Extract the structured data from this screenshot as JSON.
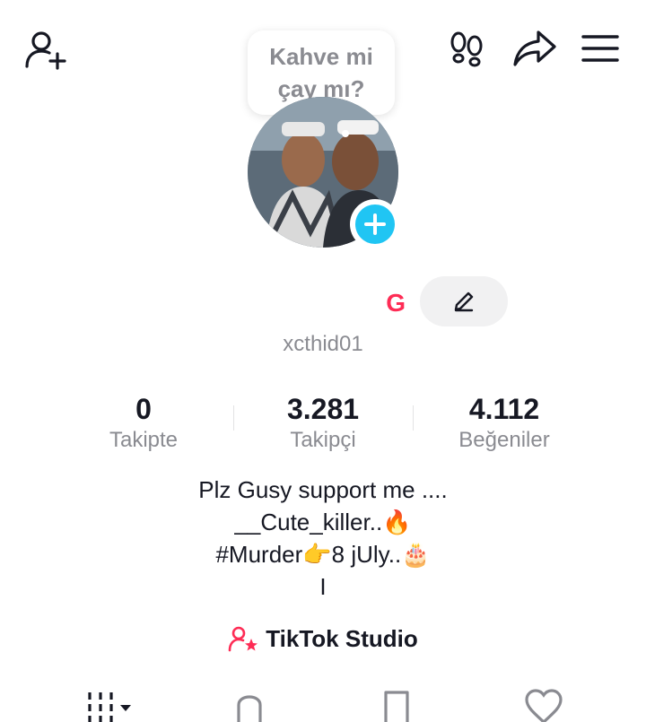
{
  "note": {
    "text": "Kahve mi\nçay mı?"
  },
  "profile": {
    "display_name": "G",
    "username": "xcthid01"
  },
  "stats": [
    {
      "value": "0",
      "label": "Takipte"
    },
    {
      "value": "3.281",
      "label": "Takipçi"
    },
    {
      "value": "4.112",
      "label": "Beğeniler"
    }
  ],
  "bio": {
    "lines": [
      "Plz Gusy support me ....",
      "__Cute_killer..🔥",
      "#Murder👉8 jUly..🎂",
      "I"
    ]
  },
  "studio": {
    "label": "TikTok Studio"
  },
  "colors": {
    "accent": "#fe2c55",
    "avatar_add": "#20c5f3",
    "text": "#161823",
    "muted": "#8a8b91"
  },
  "icons": {
    "top_left": "add-friend-icon",
    "top_right": [
      "footprints-icon",
      "share-icon",
      "menu-icon"
    ],
    "tabs": [
      "grid-icon",
      "lock-icon",
      "bookmark-icon",
      "heart-icon"
    ]
  }
}
